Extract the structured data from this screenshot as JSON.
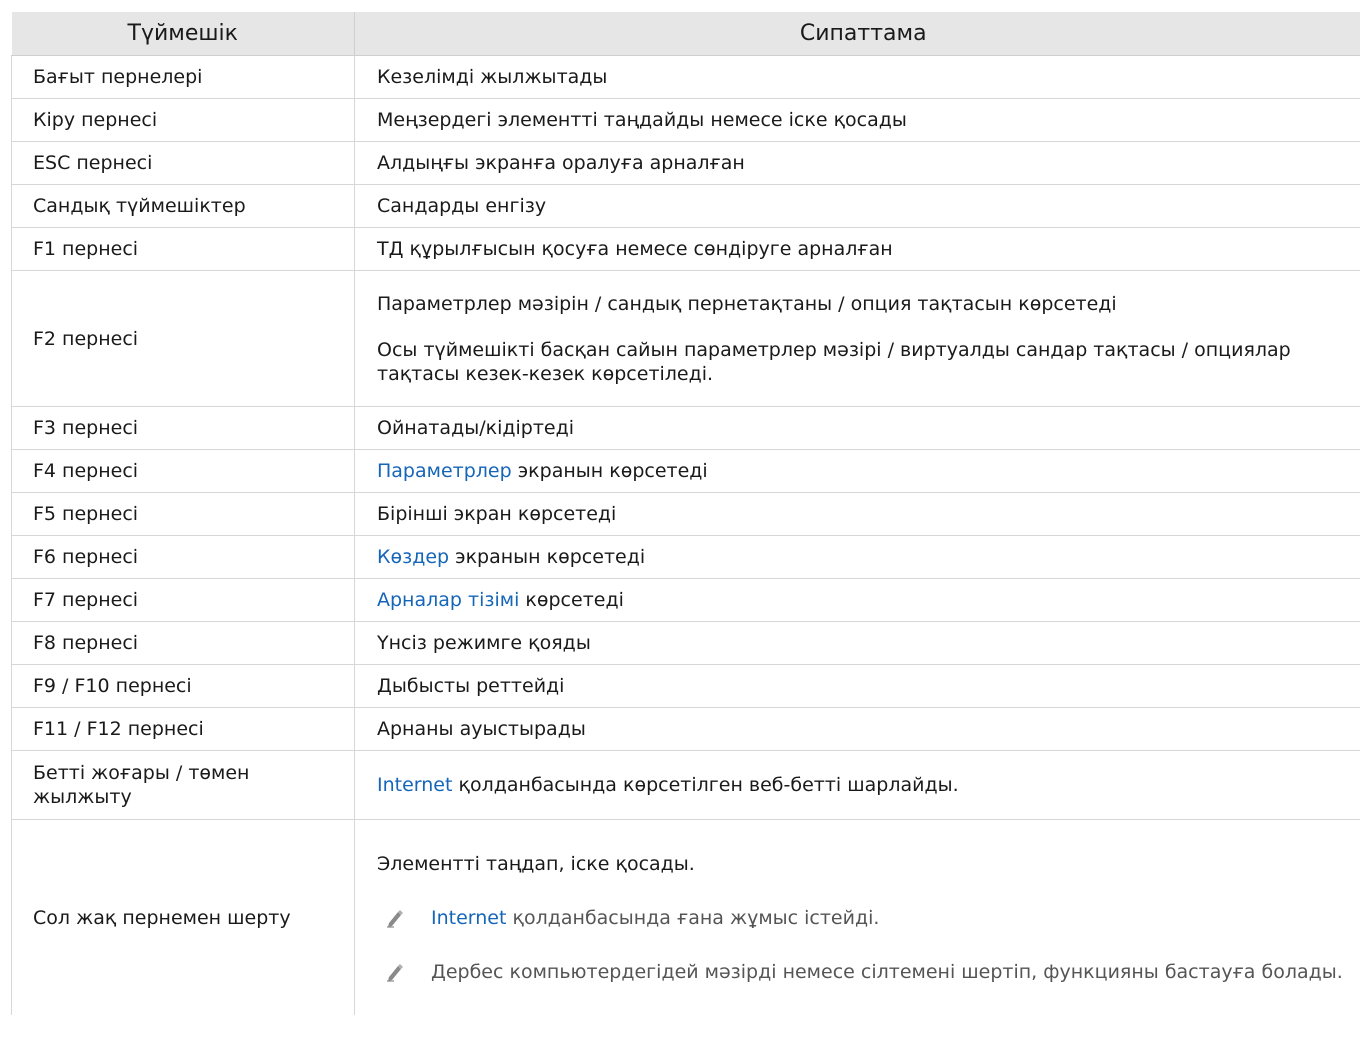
{
  "header": {
    "col_key": "Түймешік",
    "col_desc": "Сипаттама"
  },
  "rows": [
    {
      "key": "Бағыт пернелері",
      "desc": "Кезелімді жылжытады"
    },
    {
      "key": "Кіру пернесі",
      "desc": "Меңзердегі элементті таңдайды немесе іске қосады"
    },
    {
      "key": "ESC пернесі",
      "desc": "Алдыңғы экранға оралуға арналған"
    },
    {
      "key": "Сандық түймешіктер",
      "desc": "Сандарды енгізу"
    },
    {
      "key": "F1 пернесі",
      "desc": "ТД құрылғысын қосуға немесе сөндіруге арналған"
    },
    {
      "key": "F2 пернесі",
      "desc1": "Параметрлер мәзірін / сандық пернетақтаны / опция тақтасын көрсетеді",
      "desc2": "Осы түймешікті басқан сайын параметрлер мәзірі / виртуалды сандар тақтасы / опциялар тақтасы кезек-кезек көрсетіледі."
    },
    {
      "key": "F3 пернесі",
      "desc": "Ойнатады/кідіртеді"
    },
    {
      "key": "F4 пернесі",
      "link": "Параметрлер",
      "desc": " экранын көрсетеді"
    },
    {
      "key": "F5 пернесі",
      "desc": "Бірінші экран көрсетеді"
    },
    {
      "key": "F6 пернесі",
      "link": "Көздер",
      "desc": " экранын көрсетеді"
    },
    {
      "key": "F7 пернесі",
      "link": "Арналар тізімі",
      "desc": " көрсетеді"
    },
    {
      "key": "F8 пернесі",
      "desc": "Үнсіз режимге қояды"
    },
    {
      "key": "F9 / F10 пернесі",
      "desc": "Дыбысты реттейді"
    },
    {
      "key": "F11 / F12 пернесі",
      "desc": "Арнаны ауыстырады"
    },
    {
      "key": "Бетті жоғары / төмен жылжыту",
      "link": "Internet",
      "desc": " қолданбасында көрсетілген веб-бетті шарлайды."
    },
    {
      "key": "Сол жақ пернемен шерту",
      "desc": "Элементті таңдап, іске қосады.",
      "note1_link": "Internet",
      "note1": " қолданбасында ғана жұмыс істейді.",
      "note2": "Дербес компьютердегідей мәзірді немесе сілтемені шертіп, функцияны бастауға болады."
    }
  ],
  "icons": {
    "note": "pencil-note-icon"
  },
  "colors": {
    "link": "#1565b8",
    "header_bg": "#e6e6e6"
  }
}
